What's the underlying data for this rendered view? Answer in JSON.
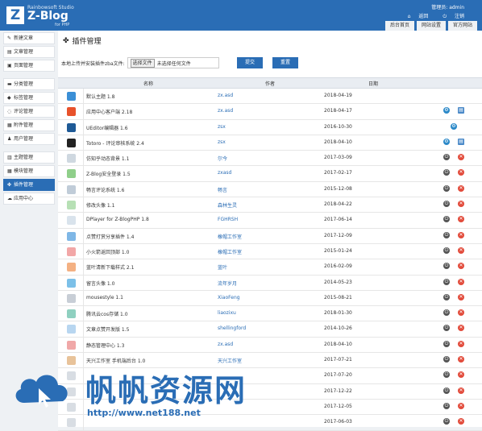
{
  "header": {
    "studio": "Rainbowsoft Studio",
    "brand": "Z-Blog",
    "for_php": "for PHP",
    "user": "管理员: admin",
    "back": "返回",
    "logout": "注销",
    "nav": [
      "后台首页",
      "网站设置",
      "官方网站"
    ]
  },
  "sidebar": {
    "items": [
      {
        "label": "新建文章",
        "icon": "edit-icon"
      },
      {
        "label": "文章管理",
        "icon": "document-icon"
      },
      {
        "label": "页面管理",
        "icon": "page-icon"
      },
      {
        "label": "分类管理",
        "icon": "folder-icon"
      },
      {
        "label": "标签管理",
        "icon": "tag-icon"
      },
      {
        "label": "评论管理",
        "icon": "comment-icon"
      },
      {
        "label": "附件管理",
        "icon": "attachment-icon"
      },
      {
        "label": "用户管理",
        "icon": "user-icon"
      },
      {
        "label": "主题管理",
        "icon": "theme-icon"
      },
      {
        "label": "模块管理",
        "icon": "module-icon"
      },
      {
        "label": "插件管理",
        "icon": "plugin-icon",
        "active": true
      },
      {
        "label": "应用中心",
        "icon": "app-center-icon"
      }
    ]
  },
  "main": {
    "title": "插件管理",
    "upload_label": "本地上传并安装插件zba文件:",
    "file_button": "选择文件",
    "file_status": "未选择任何文件",
    "submit_button": "提交",
    "reset_button": "重置",
    "columns": [
      "名称",
      "作者",
      "日期"
    ],
    "rows": [
      {
        "name": "默认主题 1.8",
        "author": "zx.asd",
        "date": "2018-04-19",
        "icon_color": "#3b8fd6",
        "actions": []
      },
      {
        "name": "应用中心客户端 2.18",
        "author": "zx.asd",
        "date": "2018-04-17",
        "icon_color": "#e8522b",
        "actions": [
          "settings",
          "manage"
        ]
      },
      {
        "name": "UEditor编辑器 1.6",
        "author": "zsx",
        "date": "2016-10-30",
        "icon_color": "#1e5a96",
        "actions": [
          "settings"
        ]
      },
      {
        "name": "Totoro - 评论审核系统 2.4",
        "author": "zsx",
        "date": "2018-04-10",
        "icon_color": "#222222",
        "actions": [
          "settings",
          "manage"
        ]
      },
      {
        "name": "仿知乎动态背景 1.1",
        "author": "尔今",
        "date": "2017-03-09",
        "icon_color": "#cfd8e0",
        "actions": [
          "power",
          "del"
        ]
      },
      {
        "name": "Z-Blog安全登录 1.5",
        "author": "zxasd",
        "date": "2017-02-17",
        "icon_color": "#8fcf8a",
        "actions": [
          "power",
          "del"
        ]
      },
      {
        "name": "畅言评论系统 1.6",
        "author": "畅言",
        "date": "2015-12-08",
        "icon_color": "#c0ccd8",
        "actions": [
          "power",
          "del"
        ]
      },
      {
        "name": "修改头像 1.1",
        "author": "森林生灵",
        "date": "2018-04-22",
        "icon_color": "#b7e0b5",
        "actions": [
          "power",
          "del"
        ]
      },
      {
        "name": "DPlayer for Z-BlogPHP 1.8",
        "author": "FGHRSH",
        "date": "2017-06-14",
        "icon_color": "#d9e3ec",
        "actions": [
          "power",
          "del"
        ]
      },
      {
        "name": "点赞打赏分享插件 1.4",
        "author": "橡帽工作室",
        "date": "2017-12-09",
        "icon_color": "#7fb7e6",
        "actions": [
          "power",
          "del"
        ]
      },
      {
        "name": "小火箭返回顶部 1.0",
        "author": "橡帽工作室",
        "date": "2015-01-24",
        "icon_color": "#f2a7a7",
        "actions": [
          "power",
          "del"
        ]
      },
      {
        "name": "蓝叶清新下载样式 2.1",
        "author": "蓝叶",
        "date": "2016-02-09",
        "icon_color": "#f4b183",
        "actions": [
          "power",
          "del"
        ]
      },
      {
        "name": "留言头像 1.0",
        "author": "流年岁月",
        "date": "2014-05-23",
        "icon_color": "#7cc0e8",
        "actions": [
          "power",
          "del"
        ]
      },
      {
        "name": "mousestyle 1.1",
        "author": "XiaoFeng",
        "date": "2015-08-21",
        "icon_color": "#c8ced6",
        "actions": [
          "power",
          "del"
        ]
      },
      {
        "name": "腾讯云cos存储 1.0",
        "author": "liaozixu",
        "date": "2018-01-30",
        "icon_color": "#8fd0c0",
        "actions": [
          "power",
          "del"
        ]
      },
      {
        "name": "文章点赞开发版 1.5",
        "author": "shellingford",
        "date": "2014-10-26",
        "icon_color": "#b8d6f0",
        "actions": [
          "power",
          "del"
        ]
      },
      {
        "name": "静态管理中心 1.3",
        "author": "zx.asd",
        "date": "2018-04-10",
        "icon_color": "#f0a8a8",
        "actions": [
          "power",
          "del"
        ]
      },
      {
        "name": "天兴工作室 手机端后台 1.0",
        "author": "天兴工作室",
        "date": "2017-07-21",
        "icon_color": "#e8c39a",
        "actions": [
          "power",
          "del"
        ]
      },
      {
        "name": "",
        "author": "",
        "date": "2017-07-20",
        "icon_color": "#d8dde3",
        "actions": [
          "power",
          "del"
        ]
      },
      {
        "name": "",
        "author": "",
        "date": "2017-12-22",
        "icon_color": "#d8dde3",
        "actions": [
          "power",
          "del"
        ]
      },
      {
        "name": "",
        "author": "",
        "date": "2017-12-05",
        "icon_color": "#d8dde3",
        "actions": [
          "power",
          "del"
        ]
      },
      {
        "name": "",
        "author": "",
        "date": "2017-06-03",
        "icon_color": "#d8dde3",
        "actions": [
          "power",
          "del"
        ]
      }
    ]
  },
  "watermark": {
    "text": "帆帆资源网",
    "url": "http://www.net188.net"
  },
  "colors": {
    "accent": "#2a6db5",
    "delete": "#e24b3b"
  }
}
